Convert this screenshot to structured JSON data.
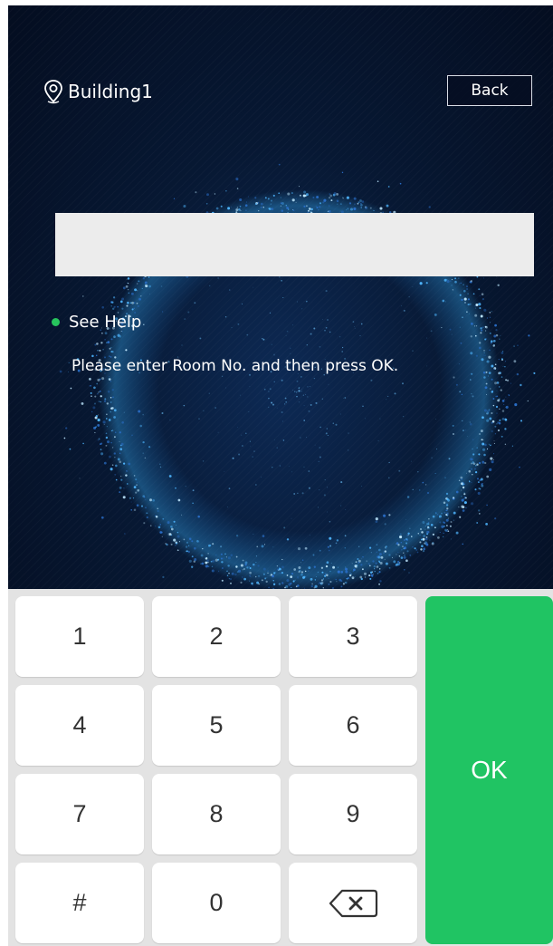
{
  "header": {
    "location_name": "Building1",
    "location_icon": "location-pin-icon",
    "back_label": "Back"
  },
  "room_input": {
    "value": "",
    "placeholder": ""
  },
  "help": {
    "label": "See Help",
    "status_color": "#27c45d"
  },
  "instruction": "Please enter Room No. and then press OK.",
  "keypad": {
    "keys": [
      "1",
      "2",
      "3",
      "4",
      "5",
      "6",
      "7",
      "8",
      "9",
      "#",
      "0"
    ],
    "delete_icon": "backspace-icon",
    "ok_label": "OK",
    "ok_color": "#20c463"
  }
}
